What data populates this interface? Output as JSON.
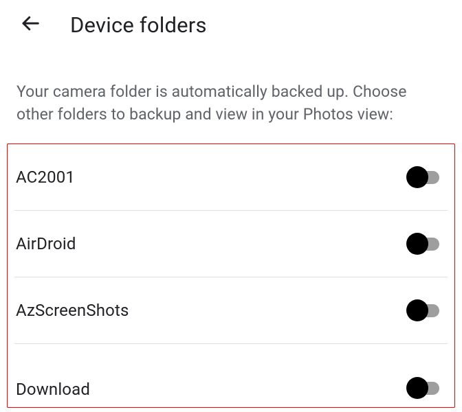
{
  "header": {
    "title": "Device folders"
  },
  "description": "Your camera folder is automatically backed up. Choose other folders to backup and view in your Photos view:",
  "folders": [
    {
      "name": "AC2001",
      "enabled": false
    },
    {
      "name": "AirDroid",
      "enabled": false
    },
    {
      "name": "AzScreenShots",
      "enabled": false
    },
    {
      "name": "Download",
      "enabled": false
    }
  ]
}
